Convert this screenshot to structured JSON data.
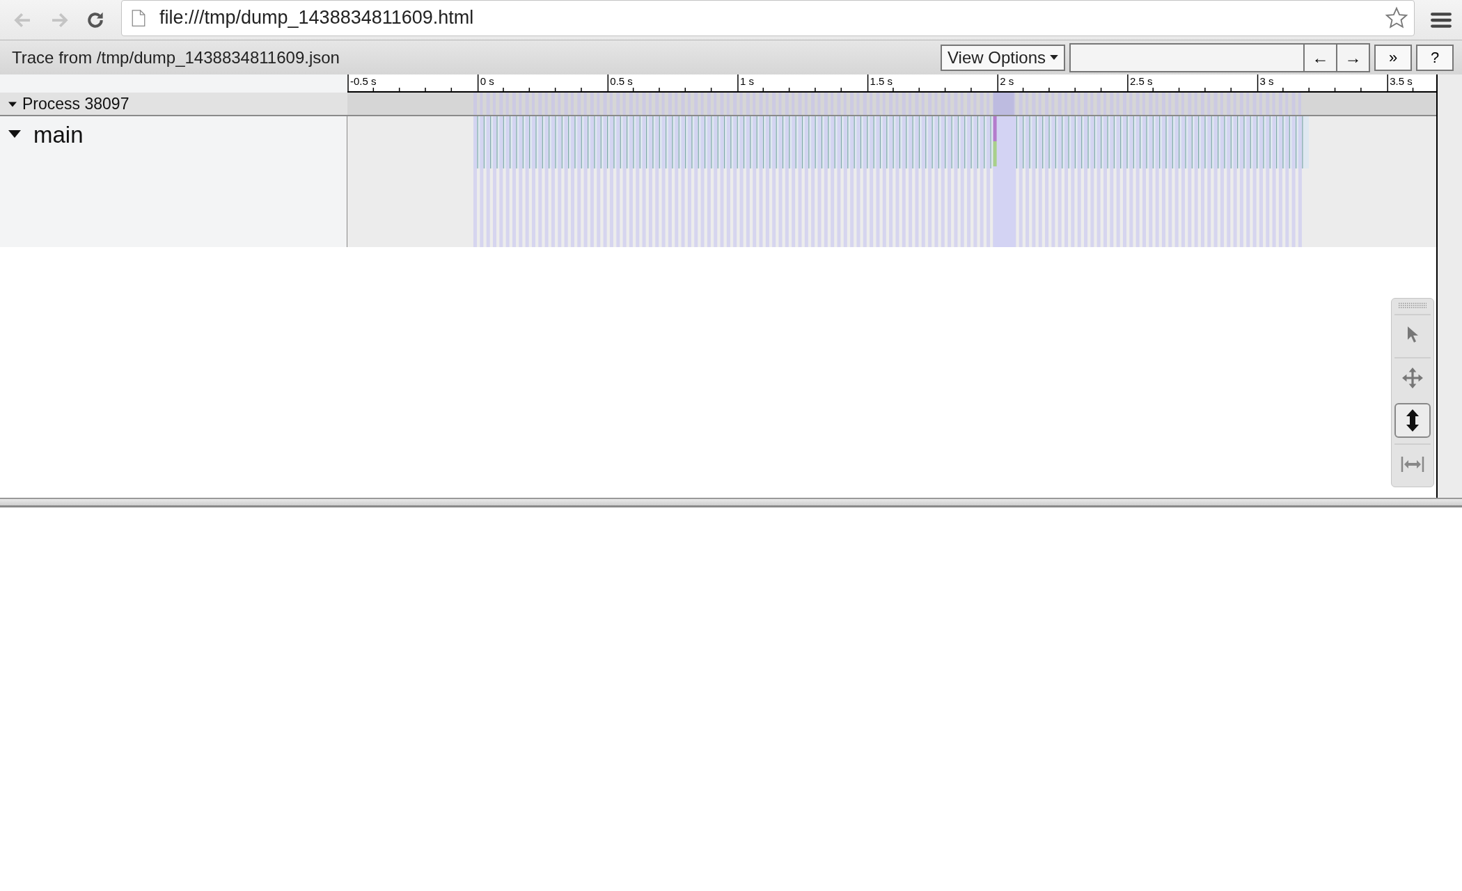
{
  "browser": {
    "url": "file:///tmp/dump_1438834811609.html"
  },
  "trace_title": "Trace from /tmp/dump_1438834811609.json",
  "controls": {
    "view_options": "View Options",
    "nav_buttons": [
      "←",
      "→"
    ],
    "more_button": "»",
    "help_button": "?"
  },
  "ruler": {
    "labels": [
      "-0.5 s",
      "0 s",
      "0.5 s",
      "1 s",
      "1.5 s",
      "2 s",
      "2.5 s",
      "3 s",
      "3.5 s"
    ]
  },
  "process": {
    "title": "Process 38097",
    "expanded": true,
    "threads": [
      {
        "name": "main",
        "expanded": true
      }
    ]
  },
  "mode_toolbar": {
    "modes": [
      {
        "kind": "selection",
        "selected": false
      },
      {
        "kind": "pan",
        "selected": false
      },
      {
        "kind": "zoom",
        "selected": true
      },
      {
        "kind": "timing",
        "selected": false
      }
    ]
  }
}
